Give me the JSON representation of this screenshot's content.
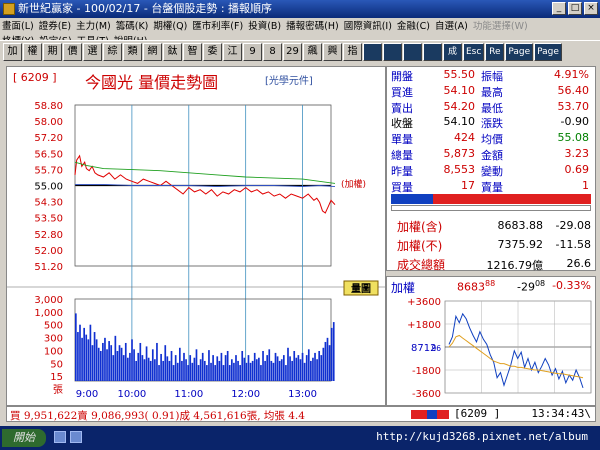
{
  "window": {
    "title": "新世紀贏家 - 100/02/17 - 台盤個股走勢 : 播報順序",
    "min": "_",
    "max": "□",
    "close": "×"
  },
  "menu": {
    "row1": [
      "畫面(L)",
      "證券(E)",
      "主力(M)",
      "籌碼(K)",
      "期權(Q)",
      "匯市利率(F)",
      "投資(B)",
      "播報密碼(H)",
      "國際資訊(I)",
      "金融(C)",
      "自選(A)",
      "功能選擇(W)"
    ],
    "row2": [
      "格標(Y)",
      "設定(S)",
      "工具(T)",
      "說明(H)"
    ]
  },
  "toolbar": [
    "加",
    "權",
    "期",
    "價",
    "選",
    "綜",
    "類",
    "網",
    "鈦",
    "智",
    "委",
    "江",
    "9",
    "8",
    "29",
    "飆",
    "興",
    "指",
    "",
    "",
    "",
    "",
    "成",
    "Esc",
    "Re",
    "Page",
    "Page"
  ],
  "chart": {
    "code": "[ 6209 ]",
    "title": "今國光  量價走勢圖",
    "subtitle": "[光學元件]",
    "ref_label": "(加權)",
    "divider_label": "量圖"
  },
  "quote": {
    "rows": [
      {
        "l1": "開盤",
        "v1": "55.50",
        "l2": "振幅",
        "v2": "4.91%"
      },
      {
        "l1": "買進",
        "v1": "54.10",
        "l2": "最高",
        "v2": "56.40"
      },
      {
        "l1": "賣出",
        "v1": "54.20",
        "l2": "最低",
        "v2": "53.70"
      },
      {
        "l1": "收盤",
        "v1": "54.10",
        "l2": "漲跌",
        "v2": "-0.90"
      },
      {
        "l1": "單量",
        "v1": "424",
        "l2": "均價",
        "v2": "55.08"
      },
      {
        "l1": "總量",
        "v1": "5,873",
        "l2": "金額",
        "v2": "3.23"
      },
      {
        "l1": "昨量",
        "v1": "8,553",
        "l2": "變動",
        "v2": "0.69"
      },
      {
        "l1": "買量",
        "v1": "17",
        "l2": "賣量",
        "v2": "1"
      }
    ],
    "index_rows": [
      {
        "label": "加權(含)",
        "value": "8683.88",
        "change": "-29.08"
      },
      {
        "label": "加權(不)",
        "value": "7375.92",
        "change": "-11.58"
      },
      {
        "label": "成交總額",
        "value": "1216.79億",
        "change": "26.6"
      }
    ]
  },
  "index_panel": {
    "label": "加權",
    "value": "8683",
    "value_dec": "88",
    "change": "-29",
    "change_dec": "08",
    "pct": "-0.33%",
    "yticks": [
      "+3600",
      "+1800",
      "8712",
      "96",
      "-1800",
      "-3600"
    ]
  },
  "status": {
    "trade_text": "買 9,951,622賣 9,086,993( 0.91)成 4,561,616張, 均張 4.4",
    "code": "[6209 ]",
    "clock": "13:34:43\\"
  },
  "taskbar": {
    "start": "開始",
    "url": "http://kujd3268.pixnet.net/album"
  },
  "chart_data": [
    {
      "type": "line",
      "title": "今國光  量價走勢圖",
      "xlabel": "",
      "ylabel": "",
      "categories": [
        "9:00",
        "10:00",
        "11:00",
        "12:00",
        "13:00"
      ],
      "ytick_labels": [
        "58.80",
        "58.00",
        "57.20",
        "56.50",
        "55.70",
        "55.00",
        "54.30",
        "53.50",
        "52.80",
        "52.00",
        "51.20"
      ],
      "ylim": [
        51.2,
        58.8
      ],
      "reference": 55.0,
      "series": [
        {
          "color": "#e00000",
          "x": [
            9.0,
            9.03,
            9.08,
            9.12,
            9.17,
            9.2,
            9.25,
            9.3,
            9.35,
            9.4,
            9.5,
            9.6,
            9.7,
            9.8,
            9.9,
            10.0,
            10.1,
            10.2,
            10.3,
            10.4,
            10.5,
            10.6,
            10.7,
            10.8,
            10.9,
            11.0,
            11.1,
            11.2,
            11.3,
            11.4,
            11.5,
            11.6,
            11.7,
            11.8,
            11.9,
            12.0,
            12.1,
            12.2,
            12.3,
            12.4,
            12.5,
            12.6,
            12.7,
            12.8,
            12.9,
            13.0,
            13.1,
            13.2,
            13.25,
            13.3,
            13.35,
            13.4,
            13.45,
            13.5,
            13.57
          ],
          "y": [
            55.5,
            56.2,
            56.4,
            55.9,
            56.1,
            55.8,
            55.7,
            55.9,
            55.6,
            55.5,
            55.4,
            55.6,
            55.3,
            55.5,
            55.3,
            55.2,
            55.1,
            55.3,
            55.2,
            55.1,
            55.0,
            55.2,
            55.0,
            54.8,
            54.6,
            54.9,
            54.7,
            54.8,
            54.6,
            54.8,
            54.5,
            54.7,
            54.6,
            54.8,
            54.7,
            54.9,
            54.7,
            54.8,
            54.6,
            54.7,
            54.5,
            54.6,
            54.4,
            54.6,
            54.5,
            54.4,
            54.6,
            54.3,
            54.4,
            54.2,
            53.8,
            53.7,
            54.0,
            54.3,
            54.1
          ]
        },
        {
          "color": "#20a020",
          "x": [
            9.0,
            9.2,
            9.5,
            10.0,
            10.5,
            11.0,
            11.5,
            12.0,
            12.5,
            13.0,
            13.57
          ],
          "y": [
            56.1,
            55.95,
            55.8,
            55.75,
            55.7,
            55.6,
            55.5,
            55.4,
            55.35,
            55.3,
            55.1
          ]
        },
        {
          "color": "#3050c0",
          "x": [
            9.0,
            9.5,
            10.0,
            10.5,
            11.0,
            11.5,
            12.0,
            12.5,
            13.0,
            13.3,
            13.57
          ],
          "y": [
            55.05,
            55.05,
            55.0,
            55.0,
            55.0,
            54.95,
            55.0,
            55.0,
            54.95,
            55.0,
            54.95
          ]
        }
      ]
    },
    {
      "type": "bar",
      "title": "",
      "xlabel": "",
      "ylabel": "張",
      "ytick_labels": [
        "3,000",
        "1,000",
        "500",
        "300",
        "100",
        "50",
        "15",
        "張"
      ],
      "values": [
        1100,
        300,
        500,
        200,
        400,
        250,
        180,
        500,
        120,
        300,
        180,
        100,
        80,
        140,
        200,
        90,
        160,
        120,
        60,
        230,
        80,
        120,
        100,
        60,
        140,
        50,
        70,
        180,
        90,
        40,
        70,
        140,
        60,
        45,
        110,
        50,
        40,
        90,
        45,
        140,
        30,
        65,
        40,
        120,
        55,
        40,
        80,
        30,
        60,
        35,
        100,
        40,
        70,
        45,
        30,
        60,
        35,
        50,
        90,
        30,
        45,
        70,
        40,
        30,
        85,
        35,
        60,
        30,
        55,
        40,
        70,
        30,
        60,
        80,
        30,
        45,
        35,
        60,
        40,
        30,
        80,
        50,
        35,
        60,
        35,
        40,
        70,
        45,
        50,
        30,
        80,
        40,
        60,
        90,
        40,
        35,
        70,
        55,
        40,
        45,
        60,
        30,
        100,
        55,
        40,
        80,
        50,
        60,
        45,
        70,
        35,
        60,
        90,
        40,
        50,
        70,
        45,
        80,
        60,
        100,
        150,
        200,
        120,
        400,
        600
      ]
    },
    {
      "type": "line",
      "title": "加權",
      "xlabel": "",
      "ylabel": "",
      "categories": [
        "9:00",
        "10:00",
        "11:00",
        "12:00",
        "13:00"
      ],
      "ytick_labels": [
        "+3600",
        "+1800",
        "8712",
        "96",
        "-1800",
        "-3600"
      ],
      "series": [
        {
          "color": "#1040c0",
          "y": [
            200,
            800,
            2400,
            1900,
            2600,
            2200,
            1500,
            900,
            400,
            1200,
            600,
            200,
            -600,
            -1200,
            -2400,
            -2000,
            -3000,
            -2200,
            -1400,
            -300,
            -900,
            -400,
            -1600,
            -900,
            -1800,
            -1200,
            -2000,
            -1500,
            -900,
            -1400,
            -2200,
            -1700,
            -2500,
            -1900,
            -2800,
            -2200,
            -2600,
            -1800,
            -2400,
            -3200
          ]
        },
        {
          "color": "#e0a020",
          "y": [
            0,
            300,
            800,
            900,
            700,
            500,
            300,
            100,
            -100,
            -300,
            -500,
            -700,
            -900,
            -1100,
            -1200,
            -1300,
            -1300,
            -1400,
            -1500,
            -1500,
            -1600,
            -1600,
            -1650,
            -1700,
            -1750,
            -1800,
            -1800,
            -1850,
            -1900,
            -1950,
            -2000,
            -2050,
            -2100,
            -2100,
            -2150,
            -2200,
            -2250,
            -2300,
            -2350,
            -2400
          ]
        }
      ]
    }
  ]
}
